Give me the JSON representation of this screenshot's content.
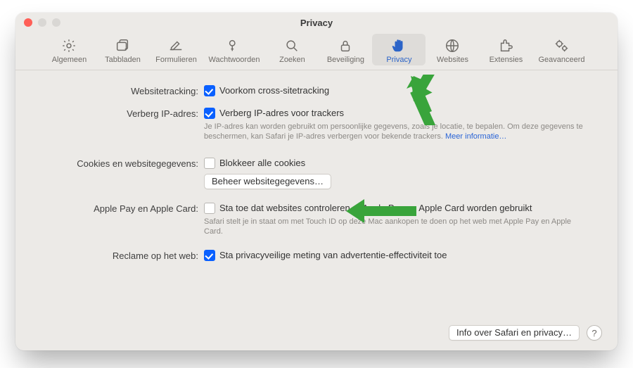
{
  "window": {
    "title": "Privacy"
  },
  "toolbar": {
    "items": [
      {
        "label": "Algemeen"
      },
      {
        "label": "Tabbladen"
      },
      {
        "label": "Formulieren"
      },
      {
        "label": "Wachtwoorden"
      },
      {
        "label": "Zoeken"
      },
      {
        "label": "Beveiliging"
      },
      {
        "label": "Privacy"
      },
      {
        "label": "Websites"
      },
      {
        "label": "Extensies"
      },
      {
        "label": "Geavanceerd"
      }
    ]
  },
  "rows": {
    "tracking": {
      "label": "Websitetracking:",
      "check": "Voorkom cross-sitetracking"
    },
    "hideip": {
      "label": "Verberg IP-adres:",
      "check": "Verberg IP-adres voor trackers",
      "desc": "Je IP-adres kan worden gebruikt om persoonlijke gegevens, zoals je locatie, te bepalen. Om deze gegevens te beschermen, kan Safari je IP-adres verbergen voor bekende trackers. ",
      "more": "Meer informatie…"
    },
    "cookies": {
      "label": "Cookies en websitegegevens:",
      "check": "Blokkeer alle cookies",
      "btn": "Beheer websitegegevens…"
    },
    "applepay": {
      "label": "Apple Pay en Apple Card:",
      "check": "Sta toe dat websites controleren of Apple Pay en Apple Card worden gebruikt",
      "desc": "Safari stelt je in staat om met Touch ID op deze Mac aankopen te doen op het web met Apple Pay en Apple Card."
    },
    "ads": {
      "label": "Reclame op het web:",
      "check": "Sta privacyveilige meting van advertentie-effectiviteit toe"
    }
  },
  "footer": {
    "info_btn": "Info over Safari en privacy…",
    "help": "?"
  }
}
